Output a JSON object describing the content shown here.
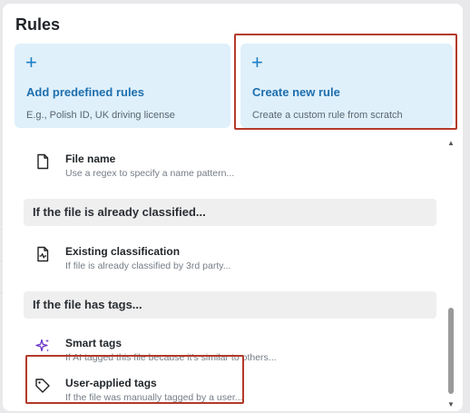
{
  "title": "Rules",
  "cards": {
    "predefined": {
      "plus": "+",
      "title": "Add predefined rules",
      "subtitle": "E.g., Polish ID, UK driving license"
    },
    "create": {
      "plus": "+",
      "title": "Create new rule",
      "subtitle": "Create a custom rule from scratch"
    }
  },
  "items": {
    "file_name": {
      "icon": "file-icon",
      "name": "File name",
      "desc": "Use a regex to specify a name pattern..."
    },
    "existing": {
      "icon": "file-chart-icon",
      "name": "Existing classification",
      "desc": "If file is already classified by 3rd party..."
    },
    "smart": {
      "icon": "sparkle-icon",
      "name": "Smart tags",
      "desc": "If AI tagged this file because it's similar to others..."
    },
    "user": {
      "icon": "tag-icon",
      "name": "User-applied tags",
      "desc": "If the file was manually tagged by a user..."
    }
  },
  "sections": {
    "classified": "If the file is already classified...",
    "tags": "If the file has tags..."
  },
  "background": {
    "left_button": "D",
    "right_text": "e"
  },
  "colors": {
    "accent": "#1e6fae",
    "card_bg": "#dff0fb",
    "highlight": "#b33a2a",
    "sparkle": "#6b35c9"
  }
}
